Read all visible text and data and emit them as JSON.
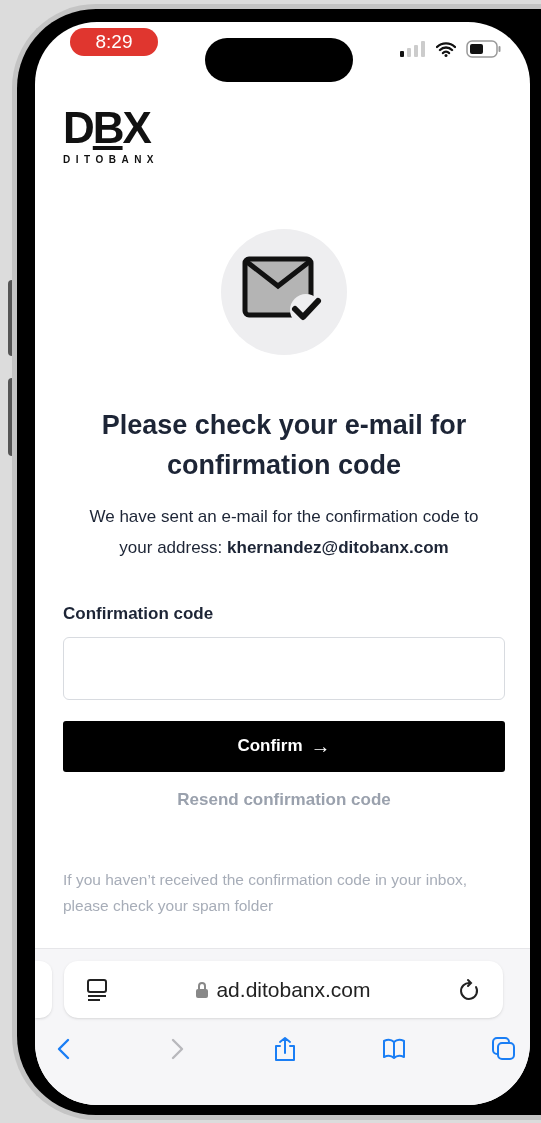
{
  "status_bar": {
    "time": "8:29"
  },
  "logo": {
    "mark": "DBX",
    "wordmark": "DITOBANX"
  },
  "title": "Please check your e-mail for confirmation code",
  "message": "We have sent an e-mail for the confirmation code to your address:  **khernandez@ditobanx.com**",
  "field": {
    "label": "Confirmation code"
  },
  "confirm_button": {
    "label": "Confirm",
    "arrow": "→"
  },
  "resend_link": "Resend confirmation code",
  "note": "If you haven’t received the confirmation code in your inbox, please check your spam folder",
  "browser": {
    "url": "ad.ditobanx.com",
    "toolbar": [
      {
        "kind": "back",
        "disabled": false
      },
      {
        "kind": "forward",
        "disabled": true
      },
      {
        "kind": "share",
        "disabled": false
      },
      {
        "kind": "bookmarks",
        "disabled": false
      },
      {
        "kind": "tabs",
        "disabled": false
      }
    ]
  }
}
